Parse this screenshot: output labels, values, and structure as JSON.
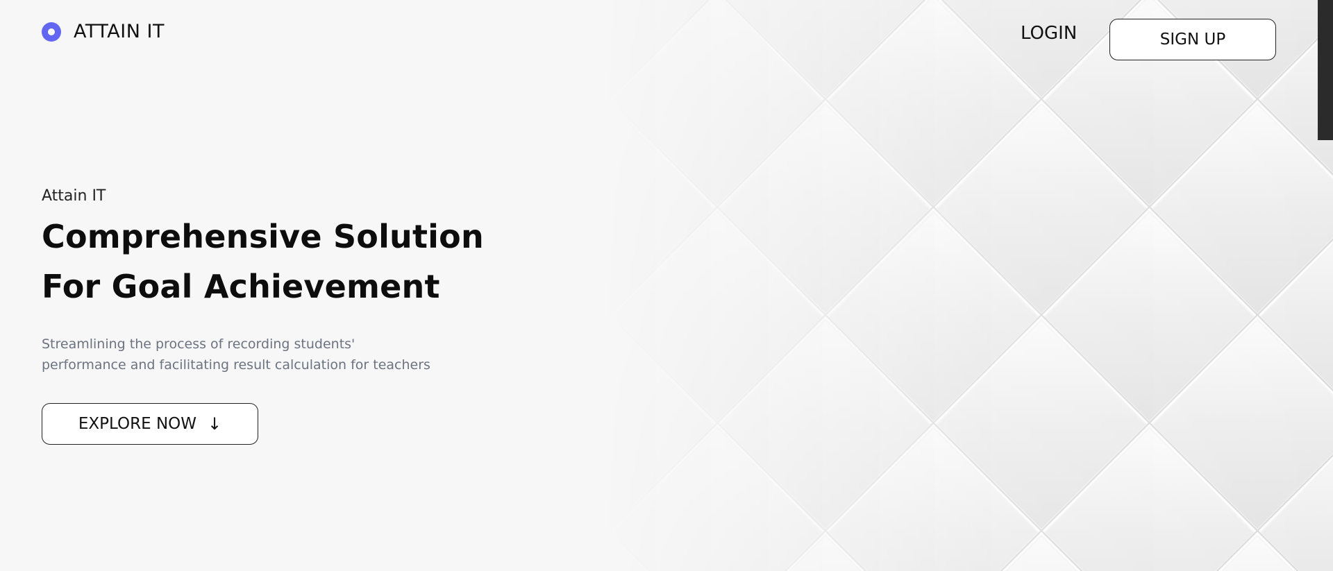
{
  "header": {
    "brand": "ATTAIN IT",
    "login_label": "LOGIN",
    "signup_label": "SIGN UP"
  },
  "hero": {
    "eyebrow": "Attain IT",
    "title_line1": "Comprehensive Solution",
    "title_line2": "For Goal Achievement",
    "desc_line1": "Streamlining the process of recording students'",
    "desc_line2": "performance and facilitating result calculation for teachers",
    "cta_label": "EXPLORE NOW",
    "cta_icon": "arrow-down-icon"
  },
  "colors": {
    "accent": "#6366f1",
    "background": "#f7f7f7",
    "text": "#111111",
    "muted_text": "#6b7280",
    "scrollbar": "#2b2b2b"
  },
  "icons": {
    "logo": "logo-circle-icon",
    "cta": "arrow-down-icon"
  }
}
